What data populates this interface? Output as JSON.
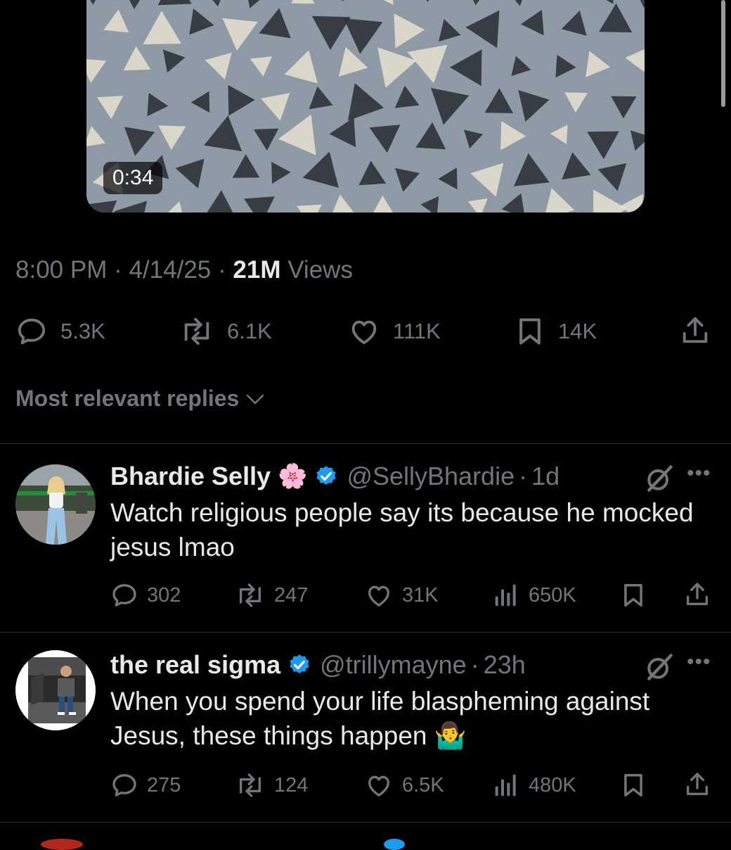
{
  "media": {
    "duration": "0:34",
    "pattern_colors": {
      "background": "#8e9ba6",
      "dark_triangle": "#2e3338",
      "light_triangle": "#e8e0cf"
    }
  },
  "post": {
    "time": "8:00 PM",
    "date": "4/14/25",
    "views_count": "21M",
    "views_label": "Views",
    "dot": "·",
    "stats": {
      "replies": "5.3K",
      "reposts": "6.1K",
      "likes": "111K",
      "bookmarks": "14K"
    }
  },
  "replies_header": {
    "label": "Most relevant replies"
  },
  "replies": [
    {
      "name": "Bhardie Selly",
      "emoji": "🌸",
      "handle": "@SellyBhardie",
      "dot": "·",
      "age": "1d",
      "text": "Watch religious people say its because he mocked jesus lmao",
      "stats": {
        "replies": "302",
        "reposts": "247",
        "likes": "31K",
        "views": "650K"
      }
    },
    {
      "name": "the real sigma",
      "handle": "@trillymayne",
      "dot": "·",
      "age": "23h",
      "text": "When you spend your life blaspheming against Jesus, these things happen",
      "emoji": "🤷‍♂️",
      "stats": {
        "replies": "275",
        "reposts": "124",
        "likes": "6.5K",
        "views": "480K"
      }
    }
  ],
  "colors": {
    "background": "#000000",
    "text_primary": "#e7e9ea",
    "text_secondary": "#71767b",
    "divider": "#2f3336",
    "verified": "#1d9bf0"
  },
  "icons": [
    "reply-icon",
    "repost-icon",
    "like-icon",
    "bookmark-icon",
    "share-icon",
    "views-icon",
    "grok-icon",
    "more-icon",
    "verified-icon",
    "chevron-down-icon"
  ]
}
